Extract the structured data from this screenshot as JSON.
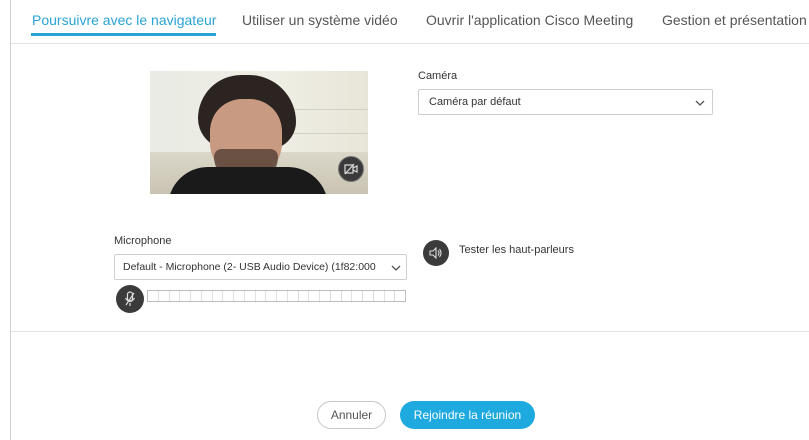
{
  "tabs": [
    {
      "label": "Poursuivre avec le navigateur",
      "active": true
    },
    {
      "label": "Utiliser un système vidéo",
      "active": false
    },
    {
      "label": "Ouvrir l'application Cisco Meeting",
      "active": false
    },
    {
      "label": "Gestion et présentation",
      "active": false
    }
  ],
  "camera": {
    "label": "Caméra",
    "selected": "Caméra par défaut"
  },
  "microphone": {
    "label": "Microphone",
    "selected": "Default - Microphone (2- USB Audio Device) (1f82:000",
    "level": 0
  },
  "speaker": {
    "test_label": "Tester les haut-parleurs"
  },
  "actions": {
    "cancel_label": "Annuler",
    "join_label": "Rejoindre la réunion"
  },
  "colors": {
    "accent": "#2aa3d6",
    "join_button": "#1ea9df"
  },
  "icons": {
    "camera_toggle": "video-off-icon",
    "microphone": "mic-off-icon",
    "speaker": "speaker-icon",
    "chevron": "chevron-down-icon"
  }
}
